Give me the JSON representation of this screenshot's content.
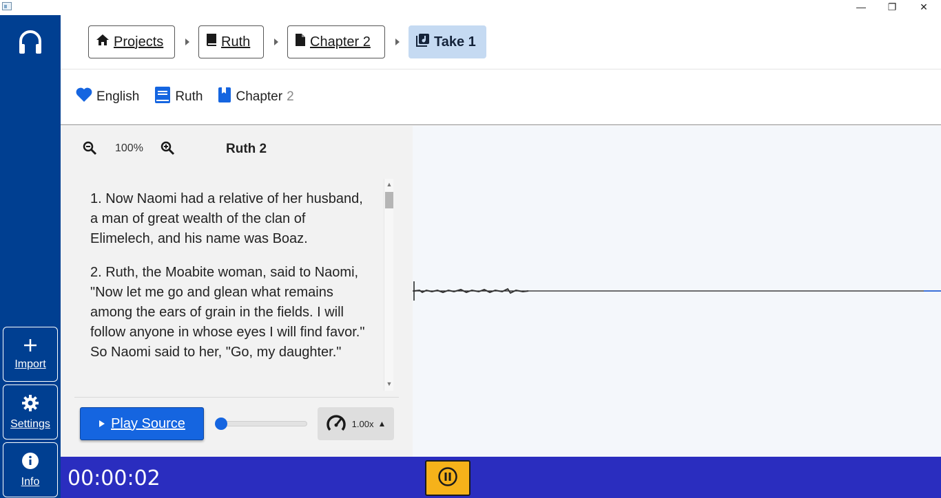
{
  "window": {
    "minimize_glyph": "—",
    "maximize_glyph": "❐",
    "close_glyph": "✕"
  },
  "sidebar": {
    "logo_icon": "headphones-icon",
    "import_label": "Import",
    "settings_label": "Settings",
    "info_label": "Info"
  },
  "breadcrumb": {
    "projects": "Projects",
    "book": "Ruth",
    "chapter": "Chapter 2",
    "take": "Take 1"
  },
  "info_bar": {
    "language": "English",
    "book": "Ruth",
    "chapter_label": "Chapter",
    "chapter_number": "2"
  },
  "source": {
    "zoom_level": "100%",
    "title": "Ruth 2",
    "verses": [
      "1. Now Naomi had a relative of her husband, a man of great wealth of the clan of Elimelech, and his name was Boaz.",
      "2. Ruth, the Moabite woman, said to Naomi, \"Now let me go and glean what remains among the ears of grain in the fields. I will follow anyone in whose eyes I will find favor.\" So Naomi said to her, \"Go, my daughter.\""
    ],
    "play_label": "Play Source",
    "playback_position": 0,
    "speed": "1.00x"
  },
  "recording": {
    "timer": "00:00:02"
  },
  "colors": {
    "sidebar": "#003f91",
    "accent": "#1565e0",
    "bottom_bar": "#2a2dbf",
    "pause_button": "#f6b21a"
  }
}
